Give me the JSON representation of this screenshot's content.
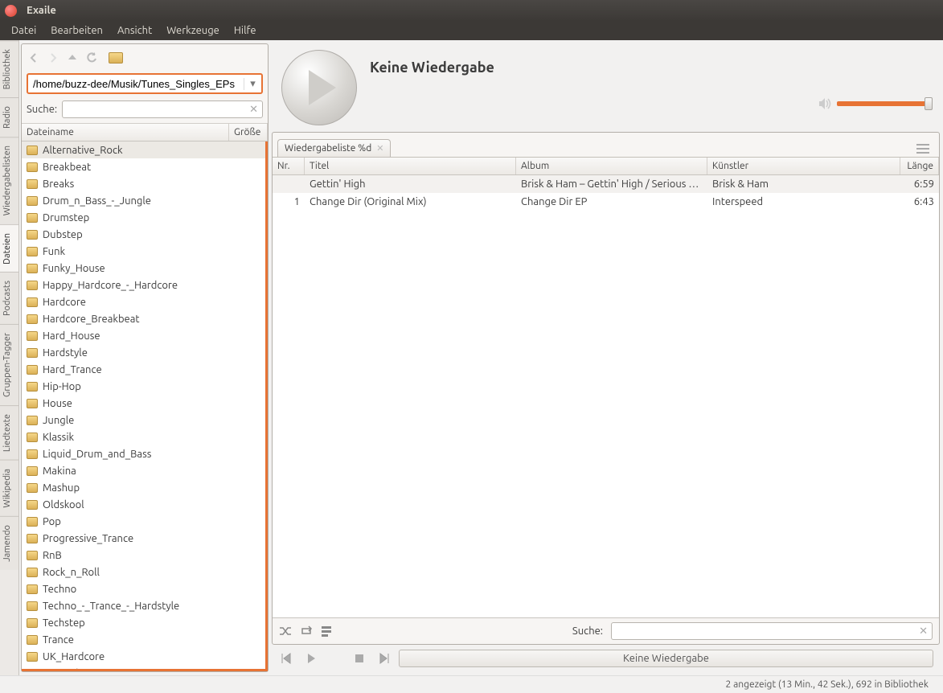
{
  "window": {
    "title": "Exaile"
  },
  "menubar": [
    "Datei",
    "Bearbeiten",
    "Ansicht",
    "Werkzeuge",
    "Hilfe"
  ],
  "side_tabs": [
    "Bibliothek",
    "Radio",
    "Wiedergabelisten",
    "Dateien",
    "Podcasts",
    "Gruppen-Tagger",
    "Liedtexte",
    "Wikipedia",
    "Jamendo"
  ],
  "side_tab_active": "Dateien",
  "left": {
    "path": "/home/buzz-dee/Musik/Tunes_Singles_EPs",
    "search_label": "Suche:",
    "headers": {
      "name": "Dateiname",
      "size": "Größe"
    },
    "folders": [
      "Alternative_Rock",
      "Breakbeat",
      "Breaks",
      "Drum_n_Bass_-_Jungle",
      "Drumstep",
      "Dubstep",
      "Funk",
      "Funky_House",
      "Happy_Hardcore_-_Hardcore",
      "Hardcore",
      "Hardcore_Breakbeat",
      "Hard_House",
      "Hardstyle",
      "Hard_Trance",
      "Hip-Hop",
      "House",
      "Jungle",
      "Klassik",
      "Liquid_Drum_and_Bass",
      "Makina",
      "Mashup",
      "Oldskool",
      "Pop",
      "Progressive_Trance",
      "RnB",
      "Rock_n_Roll",
      "Techno",
      "Techno_-_Trance_-_Hardstyle",
      "Techstep",
      "Trance",
      "UK_Hardcore",
      "UK_Makina"
    ],
    "selected": "Alternative_Rock"
  },
  "player": {
    "now_playing": "Keine Wiedergabe"
  },
  "playlist": {
    "tab_label": "Wiedergabeliste %d",
    "columns": {
      "nr": "Nr.",
      "title": "Titel",
      "album": "Album",
      "artist": "Künstler",
      "length": "Länge"
    },
    "rows": [
      {
        "nr": "",
        "title": "Gettin' High",
        "album": "Brisk & Ham – Gettin' High / Serious Har…",
        "artist": "Brisk & Ham",
        "length": "6:59"
      },
      {
        "nr": "1",
        "title": "Change Dir (Original Mix)",
        "album": "Change Dir EP",
        "artist": "Interspeed",
        "length": "6:43"
      }
    ],
    "footer_search_label": "Suche:"
  },
  "transport": {
    "track_label": "Keine Wiedergabe"
  },
  "status": "2 angezeigt (13 Min., 42 Sek.), 692 in Bibliothek"
}
